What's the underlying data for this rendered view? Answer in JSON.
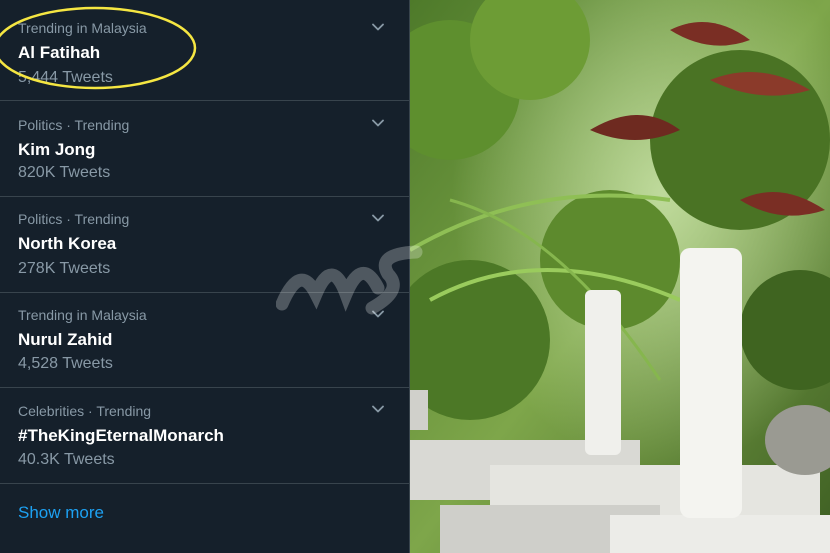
{
  "trends": [
    {
      "context": "Trending in Malaysia",
      "name": "Al Fatihah",
      "count": "5,444 Tweets"
    },
    {
      "context": "Politics · Trending",
      "name": "Kim Jong",
      "count": "820K Tweets"
    },
    {
      "context": "Politics · Trending",
      "name": "North Korea",
      "count": "278K Tweets"
    },
    {
      "context": "Trending in Malaysia",
      "name": "Nurul Zahid",
      "count": "4,528 Tweets"
    },
    {
      "context": "Celebrities · Trending",
      "name": "#TheKingEternalMonarch",
      "count": "40.3K Tweets"
    }
  ],
  "show_more": "Show more",
  "colors": {
    "background": "#15202b",
    "divider": "#38444d",
    "secondary_text": "#8899a6",
    "link": "#1da1f2",
    "highlight_circle": "#f5e642"
  }
}
